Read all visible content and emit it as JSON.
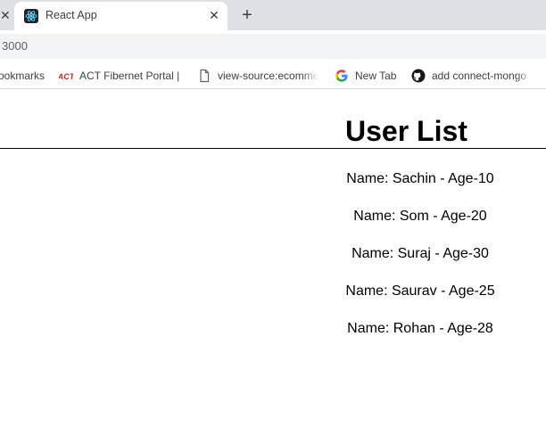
{
  "browser": {
    "tab": {
      "title": "React App"
    },
    "address": "3000",
    "bookmarks": [
      {
        "label": "ookmarks",
        "icon": "none"
      },
      {
        "label": "ACT Fibernet Portal |",
        "icon": "act-logo-icon"
      },
      {
        "label": "view-source:ecomme",
        "icon": "page-icon"
      },
      {
        "label": "New Tab",
        "icon": "google-icon"
      },
      {
        "label": "add connect-mongo",
        "icon": "github-icon"
      }
    ]
  },
  "page": {
    "heading": "User List",
    "users": [
      "Name: Sachin - Age-10",
      "Name: Som - Age-20",
      "Name: Suraj - Age-30",
      "Name: Saurav - Age-25",
      "Name: Rohan - Age-28"
    ]
  }
}
